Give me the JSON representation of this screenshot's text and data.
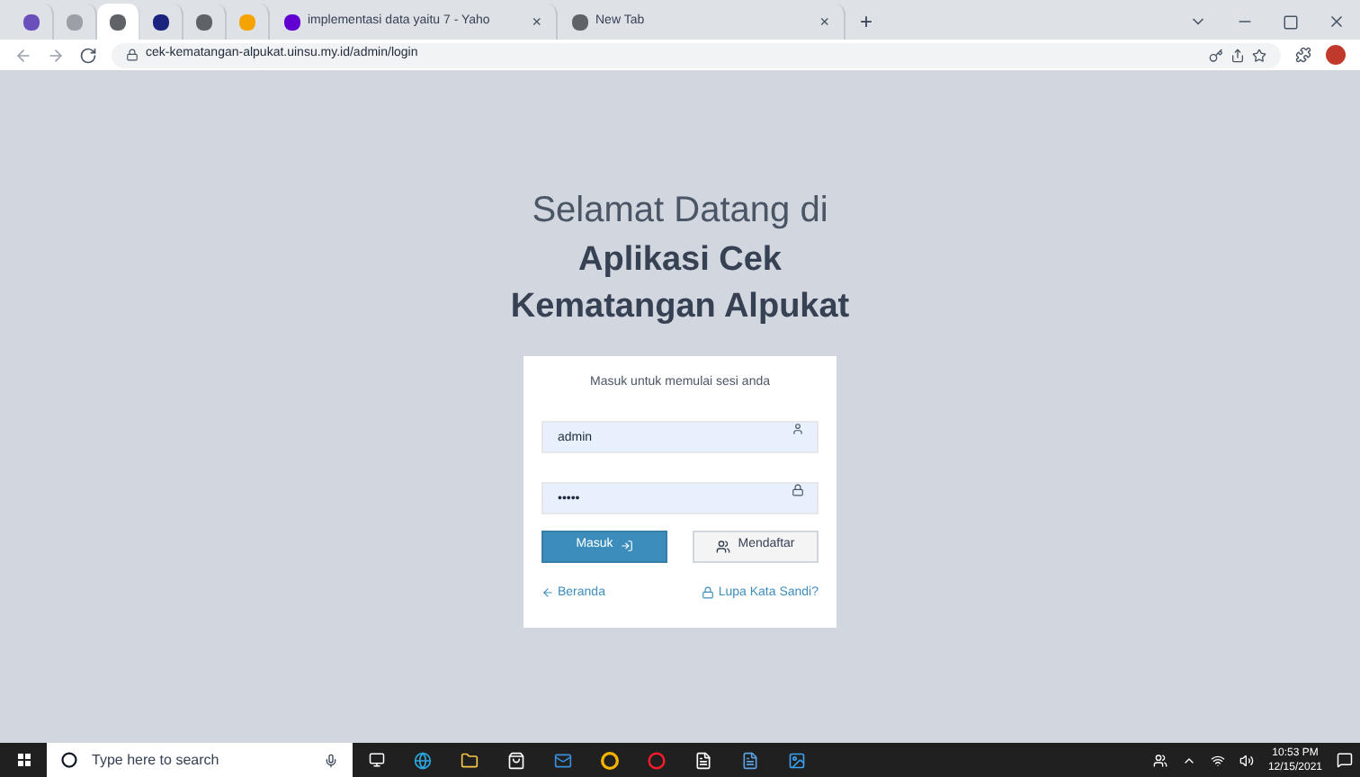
{
  "browser": {
    "tabs": [
      {
        "kind": "icon",
        "color": "#6b4fbb",
        "selected": false
      },
      {
        "kind": "icon",
        "color": "#9aa0a6",
        "selected": false
      },
      {
        "kind": "icon",
        "color": "#5f6368",
        "selected": true
      },
      {
        "kind": "icon",
        "color": "#1a237e",
        "selected": false
      },
      {
        "kind": "icon",
        "color": "#5f6368",
        "selected": false
      },
      {
        "kind": "icon",
        "color": "#f4a300",
        "selected": false
      },
      {
        "kind": "text",
        "color": "#6001d2",
        "title": "implementasi data yaitu 7 - Yaho",
        "close": "×",
        "selected": false
      },
      {
        "kind": "text",
        "color": "#5f6368",
        "title": "New Tab",
        "close": "×",
        "selected": false
      }
    ],
    "new_tab": "+",
    "url": "cek-kematangan-alpukat.uinsu.my.id/admin/login"
  },
  "heading": {
    "line_1": "Selamat Datang di",
    "line_2": "Aplikasi Cek",
    "line_3": "Kematangan Alpukat"
  },
  "login": {
    "subtitle": "Masuk untuk memulai sesi anda",
    "username": "admin",
    "password": "•••••",
    "submit": "Masuk",
    "register": "Mendaftar",
    "back_link": "Beranda",
    "forgot_link": "Lupa Kata Sandi?"
  },
  "taskbar": {
    "search_placeholder": "Type here to search",
    "time": "10:53 PM",
    "date": "12/15/2021"
  }
}
